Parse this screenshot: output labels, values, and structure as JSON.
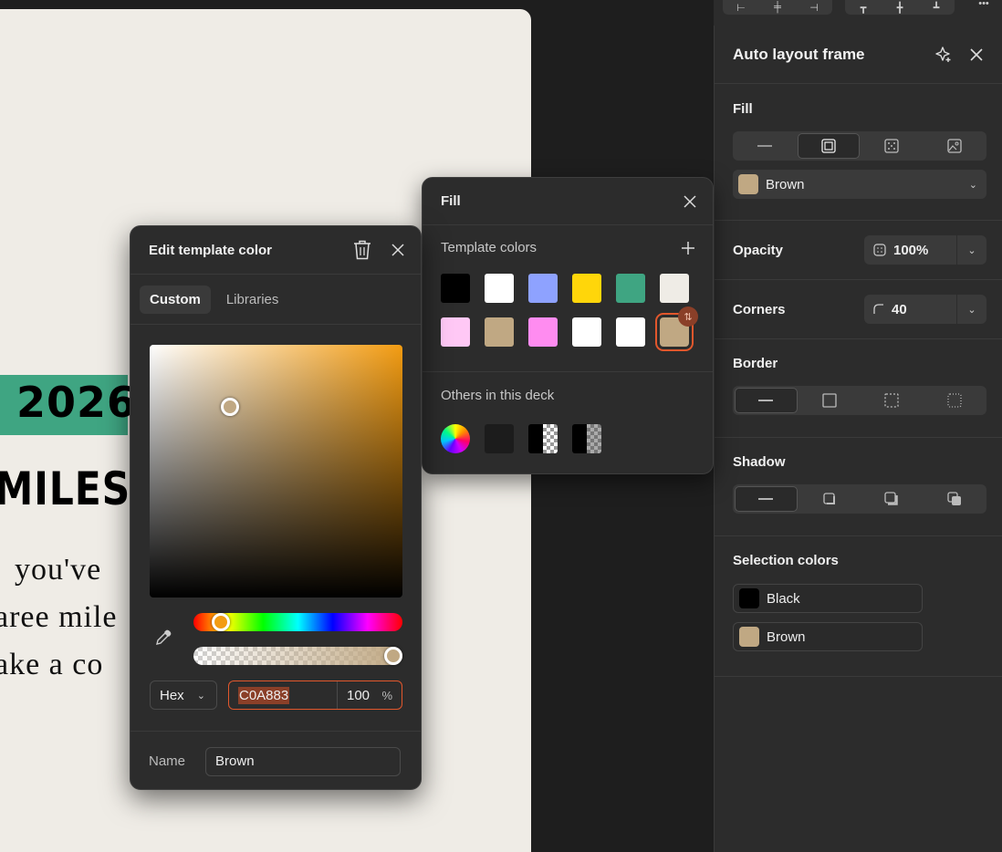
{
  "canvas": {
    "year": "2026",
    "heading": "MILEST",
    "lines": [
      "you've",
      "aree  mile",
      "ake  a  co"
    ]
  },
  "panel": {
    "title": "Auto layout frame",
    "fill": {
      "label": "Fill",
      "selected_color": "Brown",
      "color_hex": "#C0A883"
    },
    "opacity": {
      "label": "Opacity",
      "value": "100%"
    },
    "corners": {
      "label": "Corners",
      "value": "40"
    },
    "border": {
      "label": "Border"
    },
    "shadow": {
      "label": "Shadow"
    },
    "selection_colors": {
      "label": "Selection colors",
      "items": [
        {
          "name": "Black",
          "color": "#000000"
        },
        {
          "name": "Brown",
          "color": "#C0A883"
        }
      ]
    }
  },
  "fill_popover": {
    "title": "Fill",
    "template_colors_label": "Template colors",
    "template_colors": [
      "#000000",
      "#FFFFFF",
      "#8EA2FF",
      "#FFD60A",
      "#3FA582",
      "#EFECE6",
      "#FFC8F5",
      "#C0A883",
      "#FF8CF0",
      "#FFFFFF",
      "#FFFFFF",
      "#C0A883"
    ],
    "others_label": "Others in this deck"
  },
  "edit_color": {
    "title": "Edit template color",
    "tabs": [
      "Custom",
      "Libraries"
    ],
    "active_tab": "Custom",
    "format": "Hex",
    "hex": "C0A883",
    "opacity": "100",
    "percent": "%",
    "name_label": "Name",
    "name": "Brown"
  }
}
